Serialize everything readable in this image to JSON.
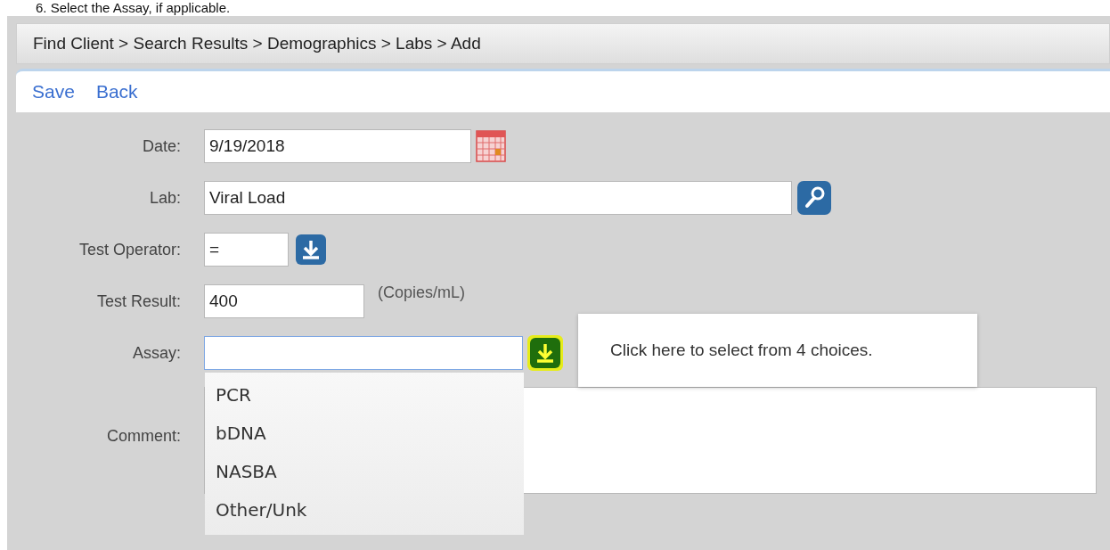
{
  "instruction": "6.  Select the Assay, if applicable.",
  "breadcrumb": "Find Client > Search Results > Demographics > Labs > Add",
  "toolbar": [
    "Save",
    "Back"
  ],
  "fields": [
    {
      "kind": "date",
      "label": "Date:",
      "value": "9/19/2018"
    },
    {
      "kind": "lookup",
      "label": "Lab:",
      "value": "Viral Load"
    },
    {
      "kind": "select",
      "label": "Test Operator:",
      "value": "=",
      "focused": false,
      "highlighted": false
    },
    {
      "kind": "number",
      "label": "Test Result:",
      "value": "400",
      "unit": "(Copies/mL)"
    },
    {
      "kind": "combo",
      "label": "Assay:",
      "focused": true,
      "highlighted": true,
      "options": [
        "PCR",
        "bDNA",
        "NASBA",
        "Other/Unk"
      ],
      "tooltip": "Click here to select from 4 choices."
    },
    {
      "kind": "textarea",
      "label": "Comment:"
    }
  ]
}
